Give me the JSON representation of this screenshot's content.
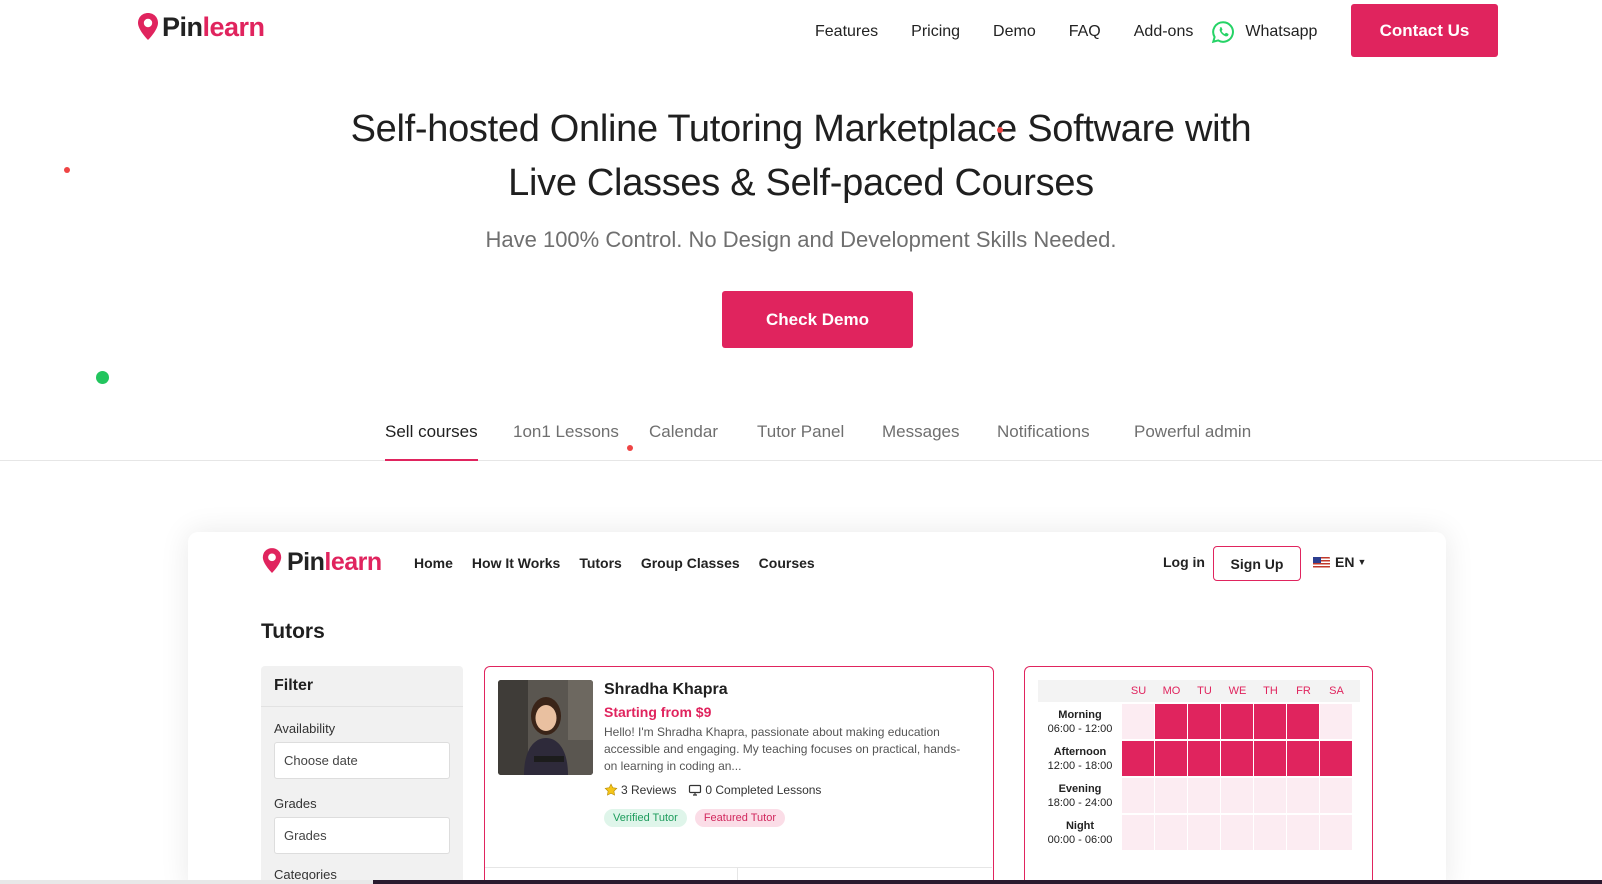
{
  "brand": {
    "part1": "Pin",
    "part2": "learn"
  },
  "nav": {
    "links": [
      "Features",
      "Pricing",
      "Demo",
      "FAQ",
      "Add-ons"
    ],
    "whatsapp": "Whatsapp",
    "contact": "Contact Us"
  },
  "hero": {
    "title_line1": "Self-hosted Online Tutoring Marketplace Software with",
    "title_line2": "Live Classes & Self-paced Courses",
    "subtitle": "Have 100% Control. No Design and Development Skills Needed.",
    "cta": "Check Demo"
  },
  "tabs": [
    "Sell courses",
    "1on1 Lessons",
    "Calendar",
    "Tutor Panel",
    "Messages",
    "Notifications",
    "Powerful admin"
  ],
  "active_tab": "Sell courses",
  "preview": {
    "nav": [
      "Home",
      "How It Works",
      "Tutors",
      "Group Classes",
      "Courses"
    ],
    "login": "Log in",
    "signup": "Sign Up",
    "lang": "EN",
    "page_title": "Tutors",
    "filter": {
      "heading": "Filter",
      "availability_label": "Availability",
      "availability_placeholder": "Choose date",
      "grades_label": "Grades",
      "grades_placeholder": "Grades",
      "categories_label": "Categories"
    },
    "tutor": {
      "name": "Shradha Khapra",
      "price": "Starting from $9",
      "bio": "Hello! I'm Shradha Khapra, passionate about making education accessible and engaging. My teaching focuses on practical, hands-on learning in coding an...",
      "reviews": "3 Reviews",
      "lessons": "0 Completed Lessons",
      "badge_verified": "Verified Tutor",
      "badge_featured": "Featured Tutor"
    },
    "schedule": {
      "days": [
        "SU",
        "MO",
        "TU",
        "WE",
        "TH",
        "FR",
        "SA"
      ],
      "slots": [
        {
          "name": "Morning",
          "time": "06:00 - 12:00",
          "on": [
            false,
            true,
            true,
            true,
            true,
            true,
            false
          ]
        },
        {
          "name": "Afternoon",
          "time": "12:00 - 18:00",
          "on": [
            true,
            true,
            true,
            true,
            true,
            true,
            true
          ]
        },
        {
          "name": "Evening",
          "time": "18:00 - 24:00",
          "on": [
            false,
            false,
            false,
            false,
            false,
            false,
            false
          ]
        },
        {
          "name": "Night",
          "time": "00:00 - 06:00",
          "on": [
            false,
            false,
            false,
            false,
            false,
            false,
            false
          ]
        }
      ]
    }
  },
  "colors": {
    "accent": "#e0245e",
    "whatsapp": "#25d366",
    "dot_green": "#22c55e",
    "dot_red": "#ef4444"
  }
}
